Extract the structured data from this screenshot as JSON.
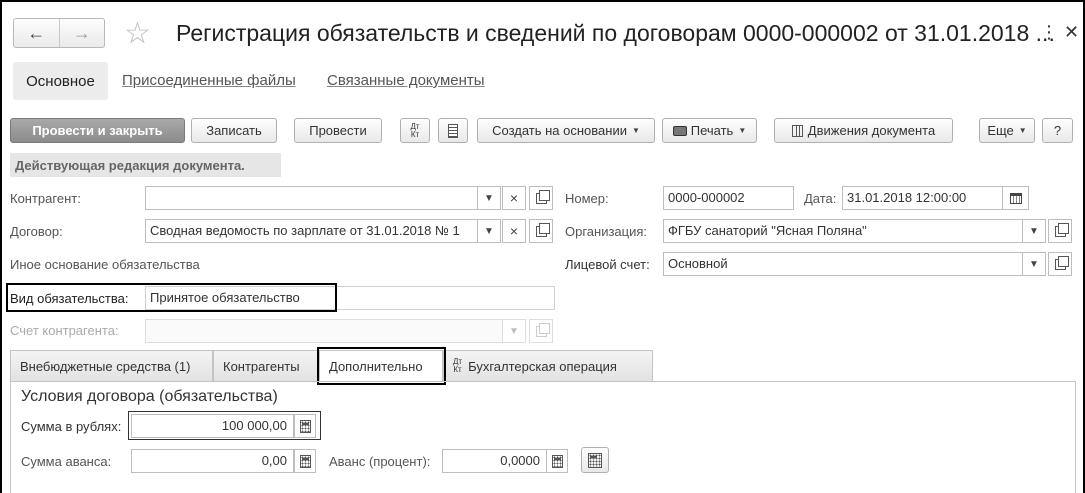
{
  "window": {
    "title": "Регистрация обязательств и сведений по договорам 0000-000002 от 31.01.2018 ...",
    "back_icon": "←",
    "forward_icon": "→",
    "star_icon": "☆",
    "more_icon": "⋮",
    "close_icon": "✕"
  },
  "tabs": {
    "main": "Основное",
    "files": "Присоединенные файлы",
    "related": "Связанные документы"
  },
  "toolbar": {
    "post_close": "Провести и закрыть",
    "save": "Записать",
    "post": "Провести",
    "dt": "Дт",
    "kt": "Кт",
    "create_based": "Создать на основании",
    "print": "Печать",
    "movements": "Движения документа",
    "more": "Еще",
    "help": "?"
  },
  "banner": "Действующая редакция документа.",
  "form": {
    "counterparty_label": "Контрагент:",
    "counterparty_value": "",
    "contract_label": "Договор:",
    "contract_value": "Сводная ведомость по зарплате от 31.01.2018 № 1",
    "other_basis_label": "Иное основание обязательства",
    "obligation_type_label": "Вид обязательства:",
    "obligation_type_value": "Принятое обязательство",
    "counterparty_account_label": "Счет контрагента:",
    "counterparty_account_value": "",
    "number_label": "Номер:",
    "number_value": "0000-000002",
    "date_label": "Дата:",
    "date_value": "31.01.2018 12:00:00",
    "org_label": "Организация:",
    "org_value": "ФГБУ санаторий \"Ясная Поляна\"",
    "account_label": "Лицевой счет:",
    "account_value": "Основной"
  },
  "inner_tabs": {
    "offbudget": "Внебюджетные средства (1)",
    "counterparties": "Контрагенты",
    "additional": "Дополнительно",
    "accounting": "Бухгалтерская операция"
  },
  "conditions": {
    "section_title": "Условия договора (обязательства)",
    "sum_rub_label": "Сумма в рублях:",
    "sum_rub_value": "100 000,00",
    "advance_sum_label": "Сумма аванса:",
    "advance_sum_value": "0,00",
    "advance_pct_label": "Аванс (процент):",
    "advance_pct_value": "0,0000"
  }
}
